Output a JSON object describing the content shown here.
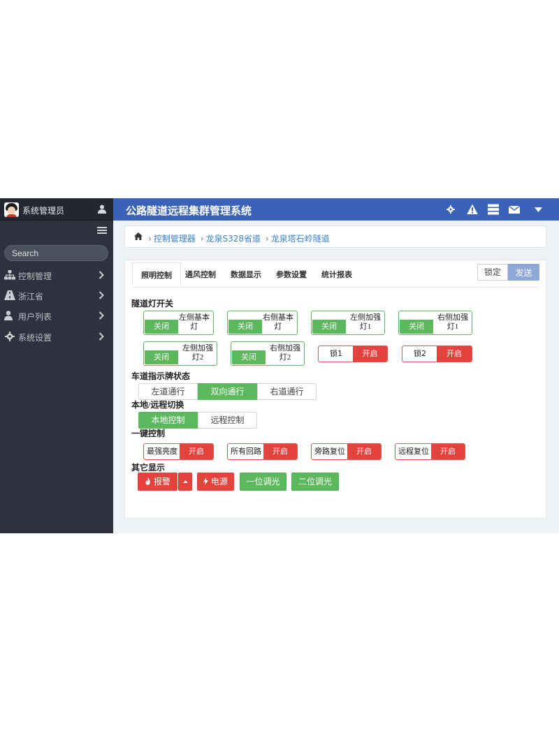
{
  "sidebar": {
    "user_name": "系统管理员",
    "search_placeholder": "Search",
    "items": [
      {
        "label": "控制管理",
        "icon": "sitemap-icon"
      },
      {
        "label": "浙江省",
        "icon": "road-icon"
      },
      {
        "label": "用户列表",
        "icon": "user-icon"
      },
      {
        "label": "系统设置",
        "icon": "gear-icon"
      }
    ]
  },
  "header": {
    "title": "公路隧道远程集群管理系统",
    "icons": [
      "gear-icon",
      "warning-icon",
      "server-icon",
      "mail-icon",
      "caret-down-icon"
    ]
  },
  "breadcrumb": [
    "控制管理器",
    "龙泉S328省道",
    "龙泉塔石岭隧道"
  ],
  "tabs": [
    "照明控制",
    "通风控制",
    "数据显示",
    "参数设置",
    "统计报表"
  ],
  "actions": {
    "lock": "锁定",
    "send": "发送"
  },
  "sections": {
    "lights": "隧道灯开关",
    "lane": "车道指示牌状态",
    "mode": "本地/远程切换",
    "onekey": "一键控制",
    "other": "其它显示"
  },
  "lights": [
    {
      "name": "左侧基本灯",
      "state": "关闭"
    },
    {
      "name": "右侧基本灯",
      "state": "关闭"
    },
    {
      "name": "左侧加强灯1",
      "state": "关闭"
    },
    {
      "name": "右侧加强灯1",
      "state": "关闭"
    },
    {
      "name": "左侧加强灯2",
      "state": "关闭"
    },
    {
      "name": "右侧加强灯2",
      "state": "关闭"
    }
  ],
  "locks": [
    {
      "name": "锁1",
      "state": "开启"
    },
    {
      "name": "锁2",
      "state": "开启"
    }
  ],
  "lane": {
    "options": [
      "左道通行",
      "双向通行",
      "右道通行"
    ],
    "selected": "双向通行"
  },
  "mode": {
    "options": [
      "本地控制",
      "远程控制"
    ],
    "selected": "本地控制"
  },
  "onekey": [
    {
      "name": "最强亮度",
      "state": "开启"
    },
    {
      "name": "所有回路",
      "state": "开启"
    },
    {
      "name": "旁路复位",
      "state": "开启"
    },
    {
      "name": "远程复位",
      "state": "开启"
    }
  ],
  "other": {
    "alarm": "报警",
    "power": "电源",
    "dim1": "一位调光",
    "dim2": "二位调光"
  },
  "colors": {
    "sidebar": "#2d323e",
    "topbar": "#3a63b7",
    "green": "#5cb85c",
    "red": "#e5413d"
  }
}
